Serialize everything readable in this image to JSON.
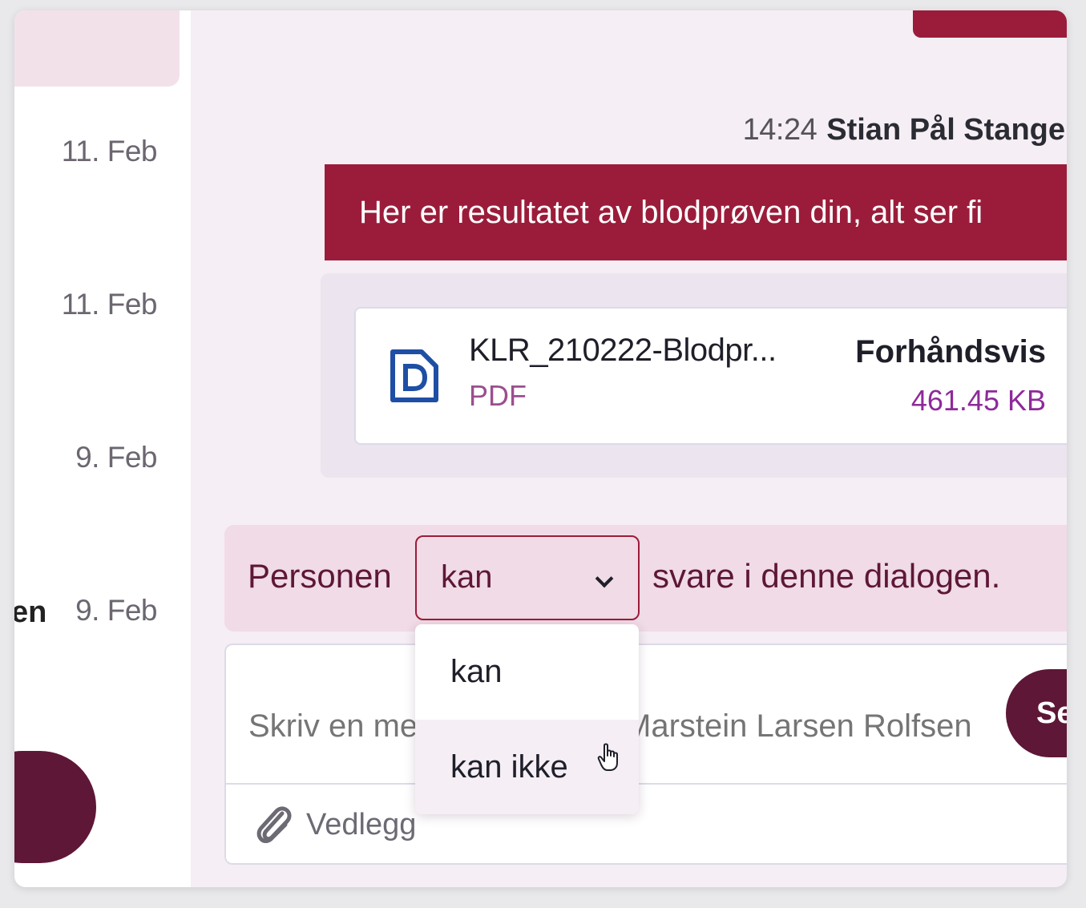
{
  "sidebar": {
    "dates": [
      "11. Feb",
      "11. Feb",
      "9. Feb",
      "9. Feb"
    ],
    "fragment_text": "en"
  },
  "message": {
    "time": "14:24",
    "sender": "Stian Pål Stange",
    "text": "Her er resultatet av blodprøven din, alt ser fi"
  },
  "attachment": {
    "icon": "pdf-document-icon",
    "file_name": "KLR_210222-Blodpr...",
    "file_type": "PDF",
    "preview_label": "Forhåndsvis",
    "file_size": "461.45 KB"
  },
  "permission": {
    "prefix": "Personen",
    "selected": "kan",
    "suffix": "svare i denne dialogen.",
    "options": [
      "kan",
      "kan ikke"
    ],
    "hovered_option": "kan ikke"
  },
  "composer": {
    "placeholder": "Skriv en melding til Kristin Marstein Larsen Rolfsen",
    "send_label": "Se",
    "attach_label": "Vedlegg",
    "attach_icon": "paperclip-icon"
  },
  "colors": {
    "primary": "#9b1c3a",
    "dark": "#5e1737",
    "background": "#f5eef4",
    "accent_size": "#8e2a9a"
  }
}
